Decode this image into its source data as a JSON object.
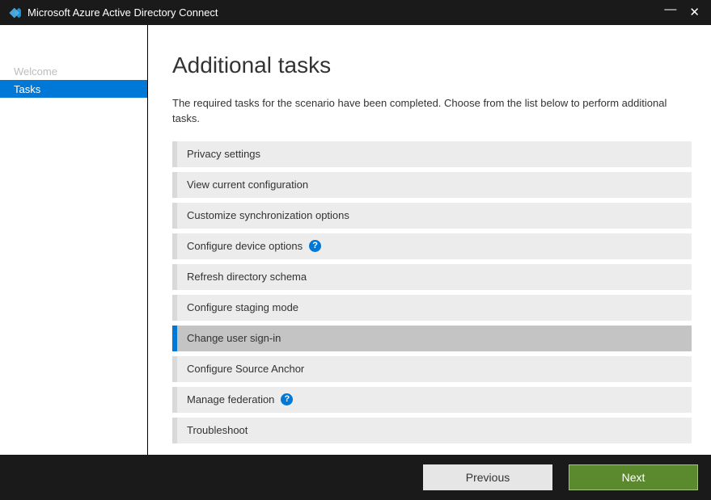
{
  "window": {
    "title": "Microsoft Azure Active Directory Connect"
  },
  "sidebar": {
    "items": [
      {
        "label": "Welcome",
        "state": "disabled"
      },
      {
        "label": "Tasks",
        "state": "active"
      }
    ]
  },
  "content": {
    "heading": "Additional tasks",
    "description": "The required tasks for the scenario have been completed. Choose from the list below to perform additional tasks.",
    "tasks": [
      {
        "label": "Privacy settings",
        "selected": false,
        "help": false
      },
      {
        "label": "View current configuration",
        "selected": false,
        "help": false
      },
      {
        "label": "Customize synchronization options",
        "selected": false,
        "help": false
      },
      {
        "label": "Configure device options",
        "selected": false,
        "help": true
      },
      {
        "label": "Refresh directory schema",
        "selected": false,
        "help": false
      },
      {
        "label": "Configure staging mode",
        "selected": false,
        "help": false
      },
      {
        "label": "Change user sign-in",
        "selected": true,
        "help": false
      },
      {
        "label": "Configure Source Anchor",
        "selected": false,
        "help": false
      },
      {
        "label": "Manage federation",
        "selected": false,
        "help": true
      },
      {
        "label": "Troubleshoot",
        "selected": false,
        "help": false
      }
    ]
  },
  "footer": {
    "previous": "Previous",
    "next": "Next"
  },
  "helpGlyph": "?"
}
